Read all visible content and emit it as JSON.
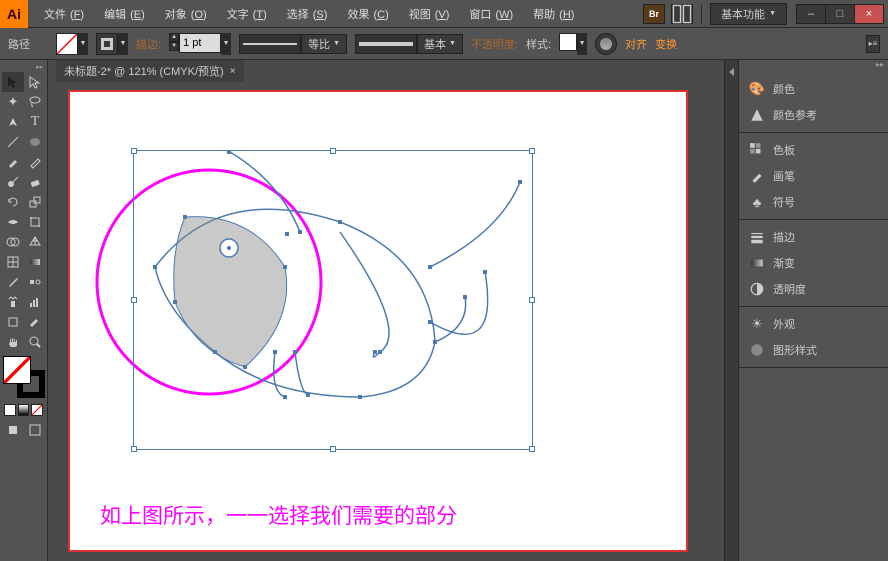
{
  "app": {
    "logo": "Ai"
  },
  "menu": [
    {
      "label": "文件",
      "key": "F"
    },
    {
      "label": "编辑",
      "key": "E"
    },
    {
      "label": "对象",
      "key": "O"
    },
    {
      "label": "文字",
      "key": "T"
    },
    {
      "label": "选择",
      "key": "S"
    },
    {
      "label": "效果",
      "key": "C"
    },
    {
      "label": "视图",
      "key": "V"
    },
    {
      "label": "窗口",
      "key": "W"
    },
    {
      "label": "帮助",
      "key": "H"
    }
  ],
  "titlebar": {
    "bridge": "Br",
    "workspace": "基本功能"
  },
  "controlbar": {
    "mode": "路径",
    "stroke_label": "描边:",
    "stroke_val": "1 pt",
    "uniform": "等比",
    "basic": "基本",
    "opacity": "不透明度:",
    "style": "样式:",
    "align": "对齐",
    "transform": "变换"
  },
  "tab": {
    "title": "未标题-2* @ 121% (CMYK/预览)",
    "close": "×"
  },
  "canvas": {
    "caption": "如上图所示，一一选择我们需要的部分"
  },
  "panels": [
    {
      "group": [
        {
          "icon": "palette",
          "label": "颜色"
        },
        {
          "icon": "guide",
          "label": "颜色参考"
        }
      ]
    },
    {
      "group": [
        {
          "icon": "swatches",
          "label": "色板"
        },
        {
          "icon": "brush",
          "label": "画笔"
        },
        {
          "icon": "symbols",
          "label": "符号"
        }
      ]
    },
    {
      "group": [
        {
          "icon": "stroke",
          "label": "描边"
        },
        {
          "icon": "gradient",
          "label": "渐变"
        },
        {
          "icon": "transparency",
          "label": "透明度"
        }
      ]
    },
    {
      "group": [
        {
          "icon": "appearance",
          "label": "外观"
        },
        {
          "icon": "graphic",
          "label": "图形样式"
        }
      ]
    }
  ],
  "win": {
    "min": "–",
    "max": "□",
    "close": "×"
  }
}
